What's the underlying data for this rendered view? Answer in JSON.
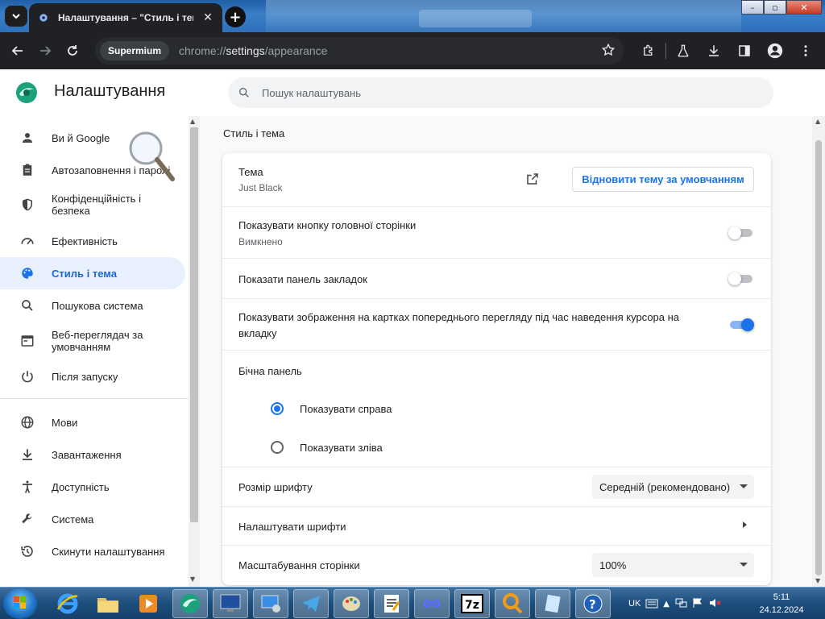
{
  "browser": {
    "tab_title": "Налаштування – \"Стиль і тема\"",
    "chip": "Supermium",
    "url_scheme": "chrome://",
    "url_host": "settings",
    "url_path": "/appearance"
  },
  "header": {
    "title": "Налаштування",
    "search_placeholder": "Пошук налаштувань"
  },
  "sidebar": {
    "items": [
      {
        "label": "Ви й Google",
        "icon": "person-icon"
      },
      {
        "label": "Автозаповнення і паролі",
        "icon": "clipboard-icon"
      },
      {
        "label": "Конфіденційність і безпека",
        "icon": "shield-icon"
      },
      {
        "label": "Ефективність",
        "icon": "speedometer-icon"
      },
      {
        "label": "Стиль і тема",
        "icon": "palette-icon",
        "active": true
      },
      {
        "label": "Пошукова система",
        "icon": "search-icon"
      },
      {
        "label": "Веб-переглядач за умовчанням",
        "icon": "browser-icon"
      },
      {
        "label": "Після запуску",
        "icon": "power-icon"
      },
      {
        "label": "Мови",
        "icon": "globe-icon"
      },
      {
        "label": "Завантаження",
        "icon": "download-icon"
      },
      {
        "label": "Доступність",
        "icon": "accessibility-icon"
      },
      {
        "label": "Система",
        "icon": "wrench-icon"
      },
      {
        "label": "Скинути налаштування",
        "icon": "history-icon"
      }
    ]
  },
  "main": {
    "section_title": "Стиль і тема",
    "theme": {
      "label": "Тема",
      "value": "Just Black",
      "reset_button": "Відновити тему за умовчанням"
    },
    "home_button": {
      "label": "Показувати кнопку головної сторінки",
      "status": "Вимкнено",
      "enabled": false
    },
    "bookmarks_bar": {
      "label": "Показати панель закладок",
      "enabled": false
    },
    "hover_preview": {
      "label": "Показувати зображення на картках попереднього перегляду під час наведення курсора на вкладку",
      "enabled": true
    },
    "side_panel": {
      "label": "Бічна панель",
      "options": [
        "Показувати справа",
        "Показувати зліва"
      ],
      "selected": 0
    },
    "font_size": {
      "label": "Розмір шрифту",
      "value": "Середній (рекомендовано)"
    },
    "customize_fonts": {
      "label": "Налаштувати шрифти"
    },
    "page_zoom": {
      "label": "Масштабування сторінки",
      "value": "100%"
    }
  },
  "taskbar": {
    "language": "UK",
    "time": "5:11",
    "date": "24.12.2024",
    "accent": "#1a73e8"
  }
}
